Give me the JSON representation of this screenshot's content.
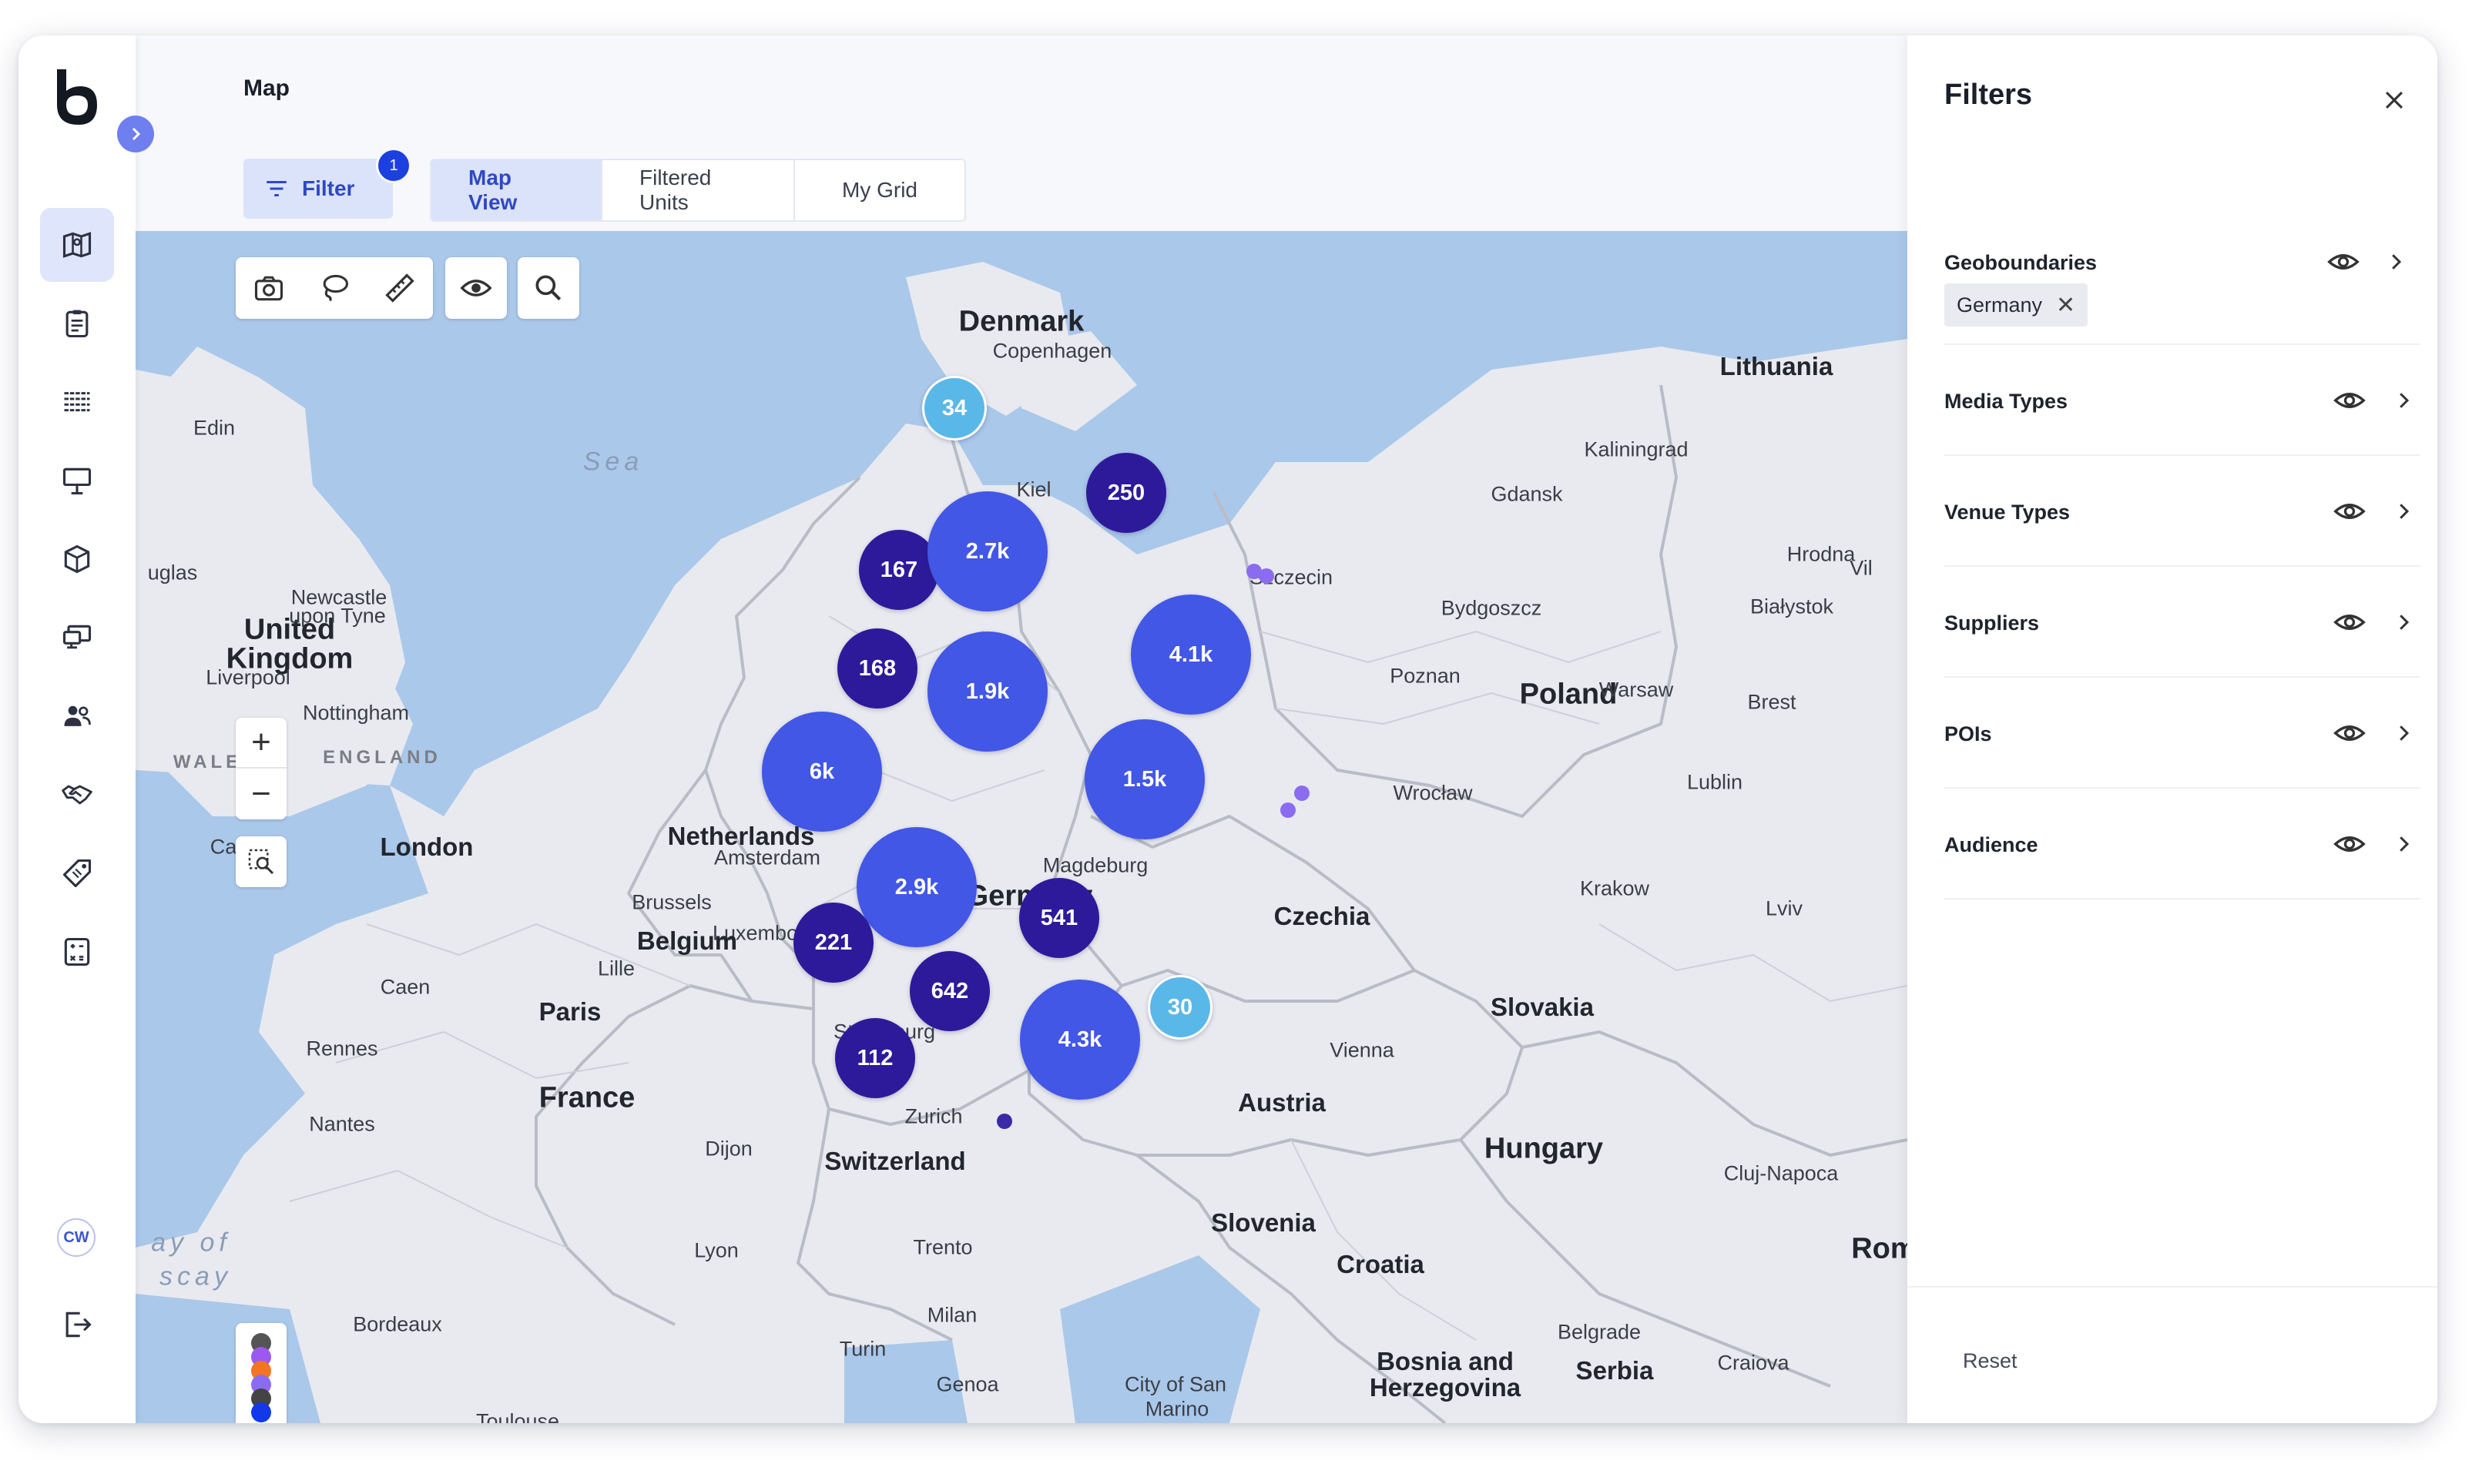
{
  "page": {
    "title": "Map"
  },
  "toolbar": {
    "filter_label": "Filter",
    "filter_count": "1",
    "tabs": [
      {
        "label": "Map View",
        "active": true
      },
      {
        "label": "Filtered Units",
        "active": false
      },
      {
        "label": "My Grid",
        "active": false
      }
    ]
  },
  "user": {
    "initials": "CW"
  },
  "sidebar": {
    "items": [
      {
        "icon": "map-icon",
        "active": true
      },
      {
        "icon": "clipboard-icon",
        "active": false
      },
      {
        "icon": "grid-dots-icon",
        "active": false
      },
      {
        "icon": "billboard-icon",
        "active": false
      },
      {
        "icon": "package-icon",
        "active": false
      },
      {
        "icon": "screens-icon",
        "active": false
      },
      {
        "icon": "people-icon",
        "active": false
      },
      {
        "icon": "handshake-icon",
        "active": false
      },
      {
        "icon": "tag-icon",
        "active": false
      },
      {
        "icon": "calculator-icon",
        "active": false
      }
    ]
  },
  "map": {
    "labels": [
      {
        "text": "Denmark",
        "kind": "country"
      },
      {
        "text": "Copenhagen",
        "kind": "city"
      },
      {
        "text": "Lithuania",
        "kind": "country-sm"
      },
      {
        "text": "Kaliningrad",
        "kind": "city"
      },
      {
        "text": "Gdansk",
        "kind": "city"
      },
      {
        "text": "Kiel",
        "kind": "city"
      },
      {
        "text": "Szczecin",
        "kind": "city"
      },
      {
        "text": "Hrodna",
        "kind": "city"
      },
      {
        "text": "Bydgoszcz",
        "kind": "city"
      },
      {
        "text": "Białystok",
        "kind": "city"
      },
      {
        "text": "Poznan",
        "kind": "city"
      },
      {
        "text": "Poland",
        "kind": "country"
      },
      {
        "text": "Warsaw",
        "kind": "city"
      },
      {
        "text": "Brest",
        "kind": "city"
      },
      {
        "text": "Lublin",
        "kind": "city"
      },
      {
        "text": "Wrocław",
        "kind": "city"
      },
      {
        "text": "Krakow",
        "kind": "city"
      },
      {
        "text": "Lviv",
        "kind": "city"
      },
      {
        "text": "Czechia",
        "kind": "country-sm"
      },
      {
        "text": "Slovakia",
        "kind": "country-sm"
      },
      {
        "text": "Vienna",
        "kind": "city"
      },
      {
        "text": "Austria",
        "kind": "country-sm"
      },
      {
        "text": "Hungary",
        "kind": "country"
      },
      {
        "text": "Cluj-Napoca",
        "kind": "city"
      },
      {
        "text": "Slovenia",
        "kind": "country-sm"
      },
      {
        "text": "Croatia",
        "kind": "country-sm"
      },
      {
        "text": "Roma",
        "kind": "country"
      },
      {
        "text": "Belgrade",
        "kind": "city"
      },
      {
        "text": "Serbia",
        "kind": "country-sm"
      },
      {
        "text": "Craiova",
        "kind": "city"
      },
      {
        "text": "Bosnia and",
        "kind": "country-sm"
      },
      {
        "text": "Herzegovina",
        "kind": "country-sm"
      },
      {
        "text": "City of San",
        "kind": "city"
      },
      {
        "text": "Marino",
        "kind": "city"
      },
      {
        "text": "Genoa",
        "kind": "city"
      },
      {
        "text": "Turin",
        "kind": "city"
      },
      {
        "text": "Milan",
        "kind": "city"
      },
      {
        "text": "Trento",
        "kind": "city"
      },
      {
        "text": "Switzerland",
        "kind": "country-sm"
      },
      {
        "text": "Zurich",
        "kind": "city"
      },
      {
        "text": "Lyon",
        "kind": "city"
      },
      {
        "text": "Dijon",
        "kind": "city"
      },
      {
        "text": "France",
        "kind": "country"
      },
      {
        "text": "Paris",
        "kind": "country-sm"
      },
      {
        "text": "Rennes",
        "kind": "city"
      },
      {
        "text": "Caen",
        "kind": "city"
      },
      {
        "text": "Nantes",
        "kind": "city"
      },
      {
        "text": "Bordeaux",
        "kind": "city"
      },
      {
        "text": "Toulouse",
        "kind": "city"
      },
      {
        "text": "Strasbourg",
        "kind": "city"
      },
      {
        "text": "Luxembourg",
        "kind": "city"
      },
      {
        "text": "Lille",
        "kind": "city"
      },
      {
        "text": "Brussels",
        "kind": "city"
      },
      {
        "text": "Belgium",
        "kind": "country-sm"
      },
      {
        "text": "Netherlands",
        "kind": "country-sm"
      },
      {
        "text": "Amsterdam",
        "kind": "city"
      },
      {
        "text": "Germany",
        "kind": "country"
      },
      {
        "text": "Magdeburg",
        "kind": "city"
      },
      {
        "text": "London",
        "kind": "country-sm"
      },
      {
        "text": "United",
        "kind": "country"
      },
      {
        "text": "Kingdom",
        "kind": "country"
      },
      {
        "text": "Newcastle",
        "kind": "city"
      },
      {
        "text": "upon Tyne",
        "kind": "city"
      },
      {
        "text": "Liverpool",
        "kind": "city"
      },
      {
        "text": "Nottingham",
        "kind": "city"
      },
      {
        "text": "ENGLAND",
        "kind": "region"
      },
      {
        "text": "WALES",
        "kind": "region"
      },
      {
        "text": "Edin",
        "kind": "city"
      },
      {
        "text": "uglas",
        "kind": "city"
      },
      {
        "text": "Ca",
        "kind": "city"
      },
      {
        "text": "Vil",
        "kind": "city"
      },
      {
        "text": "Sea",
        "kind": "sea"
      },
      {
        "text": "ay of",
        "kind": "sea"
      },
      {
        "text": "scay",
        "kind": "sea"
      }
    ],
    "clusters": [
      {
        "label": "34",
        "tier": "small"
      },
      {
        "label": "250",
        "tier": "dark"
      },
      {
        "label": "167",
        "tier": "dark"
      },
      {
        "label": "2.7k",
        "tier": "large"
      },
      {
        "label": "168",
        "tier": "dark"
      },
      {
        "label": "1.9k",
        "tier": "large"
      },
      {
        "label": "4.1k",
        "tier": "large"
      },
      {
        "label": "6k",
        "tier": "large"
      },
      {
        "label": "1.5k",
        "tier": "large"
      },
      {
        "label": "2.9k",
        "tier": "large"
      },
      {
        "label": "541",
        "tier": "dark"
      },
      {
        "label": "221",
        "tier": "dark"
      },
      {
        "label": "642",
        "tier": "dark"
      },
      {
        "label": "30",
        "tier": "small"
      },
      {
        "label": "4.3k",
        "tier": "large"
      },
      {
        "label": "112",
        "tier": "dark"
      }
    ],
    "tier_colors": {
      "small": "#5ab8e8",
      "dark": "#2d1a9a",
      "large": "#4257e6"
    },
    "dot_colors": [
      "#8b6cf0",
      "#8b6cf0",
      "#8b6cf0",
      "#8b6cf0",
      "#3a2aa8"
    ],
    "legend_colors": [
      "#555555",
      "#9b59f0",
      "#f27521",
      "#8b6cf0",
      "#444444",
      "#1238e8"
    ],
    "tools": [
      "camera-icon",
      "lasso-icon",
      "ruler-icon",
      "eye-icon",
      "search-icon"
    ],
    "zoom_in": "+",
    "zoom_out": "−"
  },
  "filters": {
    "title": "Filters",
    "sections": [
      {
        "label": "Geoboundaries",
        "chips": [
          "Germany"
        ]
      },
      {
        "label": "Media Types"
      },
      {
        "label": "Venue Types"
      },
      {
        "label": "Suppliers"
      },
      {
        "label": "POIs"
      },
      {
        "label": "Audience"
      }
    ],
    "reset_label": "Reset"
  }
}
